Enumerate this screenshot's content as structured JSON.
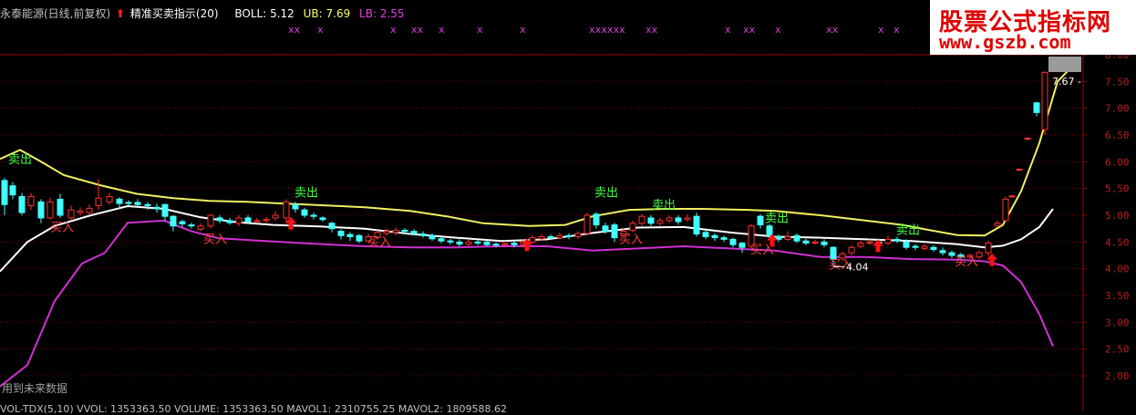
{
  "header": {
    "stock_title": "永泰能源(日线,前复权)",
    "indicator_name": "精准买卖指示(20)",
    "boll_label": "BOLL: 5.12",
    "ub_label": "UB: 7.69",
    "lb_label": "LB: 2.55",
    "colors": {
      "title": "#c0c0c0",
      "indicator": "#ffffff",
      "arrow": "#ff2020",
      "boll": "#ffffff",
      "ub": "#ffff60",
      "lb": "#e040e0"
    }
  },
  "watermark": {
    "line1": "股票公式指标网",
    "line2": "www.gszb.com"
  },
  "footer": {
    "future_warning": "用到未来数据",
    "volume_line": "VOL-TDX(5,10)  VVOL: 1353363.50  VOLUME: 1353363.50  MAVOL1: 2310755.25  MAVOL2: 1809588.62"
  },
  "chart_data": {
    "type": "candlestick",
    "yticks": [
      "8.00",
      "7.50",
      "7.00",
      "6.50",
      "6.00",
      "5.50",
      "5.00",
      "4.50",
      "4.00",
      "3.50",
      "3.00",
      "2.50",
      "2.00"
    ],
    "ylim": [
      1.9,
      8.05
    ],
    "price_box_label": "7.67",
    "low_label": "4.04",
    "x_marks": [
      {
        "x": 316,
        "text": "xx"
      },
      {
        "x": 348,
        "text": "x"
      },
      {
        "x": 428,
        "text": "x"
      },
      {
        "x": 451,
        "text": "xx"
      },
      {
        "x": 481,
        "text": "x"
      },
      {
        "x": 523,
        "text": "x"
      },
      {
        "x": 570,
        "text": "x"
      },
      {
        "x": 646,
        "text": "xxxxxx"
      },
      {
        "x": 708,
        "text": "xx"
      },
      {
        "x": 795,
        "text": "x"
      },
      {
        "x": 815,
        "text": "xx"
      },
      {
        "x": 850,
        "text": "x"
      },
      {
        "x": 906,
        "text": "xx"
      },
      {
        "x": 963,
        "text": "x"
      },
      {
        "x": 980,
        "text": "x"
      }
    ],
    "sell_labels": [
      {
        "x": 22,
        "v": 5.97,
        "text": "卖出"
      },
      {
        "x": 336,
        "v": 5.35,
        "text": "卖出"
      },
      {
        "x": 665,
        "v": 5.35,
        "text": "卖出"
      },
      {
        "x": 728,
        "v": 5.12,
        "text": "卖出"
      },
      {
        "x": 852,
        "v": 4.87,
        "text": "卖出"
      },
      {
        "x": 996,
        "v": 4.65,
        "text": "卖出"
      }
    ],
    "buy_labels": [
      {
        "x": 68,
        "v": 4.7,
        "text": "买入"
      },
      {
        "x": 236,
        "v": 4.48,
        "text": "买入"
      },
      {
        "x": 416,
        "v": 4.43,
        "text": "买入"
      },
      {
        "x": 692,
        "v": 4.48,
        "text": "买入"
      },
      {
        "x": 836,
        "v": 4.28,
        "text": "买入"
      },
      {
        "x": 922,
        "v": 4.0,
        "text": "买入"
      },
      {
        "x": 1060,
        "v": 4.06,
        "text": "买入"
      }
    ],
    "buy_arrows": [
      {
        "x": 319,
        "v": 4.8
      },
      {
        "x": 578,
        "v": 4.4
      },
      {
        "x": 847,
        "v": 4.48
      },
      {
        "x": 963,
        "v": 4.38
      },
      {
        "x": 1088,
        "v": 4.12
      }
    ],
    "ub": [
      [
        0,
        6.05
      ],
      [
        22,
        6.22
      ],
      [
        45,
        6.0
      ],
      [
        70,
        5.75
      ],
      [
        110,
        5.56
      ],
      [
        150,
        5.4
      ],
      [
        190,
        5.32
      ],
      [
        230,
        5.27
      ],
      [
        270,
        5.25
      ],
      [
        310,
        5.22
      ],
      [
        350,
        5.19
      ],
      [
        400,
        5.15
      ],
      [
        450,
        5.08
      ],
      [
        490,
        4.98
      ],
      [
        530,
        4.85
      ],
      [
        580,
        4.8
      ],
      [
        620,
        4.82
      ],
      [
        650,
        4.98
      ],
      [
        690,
        5.1
      ],
      [
        730,
        5.12
      ],
      [
        770,
        5.12
      ],
      [
        820,
        5.1
      ],
      [
        850,
        5.08
      ],
      [
        900,
        5.0
      ],
      [
        950,
        4.9
      ],
      [
        990,
        4.82
      ],
      [
        1020,
        4.72
      ],
      [
        1050,
        4.63
      ],
      [
        1080,
        4.62
      ],
      [
        1100,
        4.82
      ],
      [
        1120,
        5.45
      ],
      [
        1140,
        6.35
      ],
      [
        1160,
        7.5
      ],
      [
        1180,
        7.85
      ]
    ],
    "mid": [
      [
        0,
        3.95
      ],
      [
        30,
        4.5
      ],
      [
        60,
        4.8
      ],
      [
        100,
        5.0
      ],
      [
        140,
        5.17
      ],
      [
        180,
        5.12
      ],
      [
        220,
        4.96
      ],
      [
        260,
        4.87
      ],
      [
        300,
        4.82
      ],
      [
        350,
        4.79
      ],
      [
        400,
        4.75
      ],
      [
        450,
        4.65
      ],
      [
        500,
        4.58
      ],
      [
        550,
        4.52
      ],
      [
        600,
        4.55
      ],
      [
        650,
        4.67
      ],
      [
        700,
        4.77
      ],
      [
        750,
        4.78
      ],
      [
        800,
        4.68
      ],
      [
        850,
        4.6
      ],
      [
        900,
        4.58
      ],
      [
        950,
        4.55
      ],
      [
        1000,
        4.52
      ],
      [
        1050,
        4.46
      ],
      [
        1080,
        4.4
      ],
      [
        1100,
        4.43
      ],
      [
        1120,
        4.55
      ],
      [
        1140,
        4.78
      ],
      [
        1155,
        5.12
      ]
    ],
    "lb": [
      [
        0,
        1.8
      ],
      [
        30,
        2.2
      ],
      [
        60,
        3.4
      ],
      [
        90,
        4.1
      ],
      [
        115,
        4.3
      ],
      [
        140,
        4.86
      ],
      [
        180,
        4.9
      ],
      [
        210,
        4.7
      ],
      [
        240,
        4.57
      ],
      [
        280,
        4.53
      ],
      [
        330,
        4.48
      ],
      [
        400,
        4.42
      ],
      [
        450,
        4.4
      ],
      [
        500,
        4.4
      ],
      [
        550,
        4.42
      ],
      [
        600,
        4.42
      ],
      [
        650,
        4.34
      ],
      [
        700,
        4.38
      ],
      [
        750,
        4.42
      ],
      [
        800,
        4.38
      ],
      [
        850,
        4.34
      ],
      [
        900,
        4.22
      ],
      [
        950,
        4.22
      ],
      [
        1000,
        4.18
      ],
      [
        1050,
        4.17
      ],
      [
        1080,
        4.14
      ],
      [
        1100,
        4.06
      ],
      [
        1120,
        3.75
      ],
      [
        1140,
        3.15
      ],
      [
        1155,
        2.55
      ]
    ],
    "candles": [
      [
        5,
        5.2,
        5.65,
        5.0,
        5.7,
        "d"
      ],
      [
        14,
        5.55,
        5.38,
        5.3,
        5.62,
        "d"
      ],
      [
        24,
        5.35,
        5.05,
        5.0,
        5.42,
        "d"
      ],
      [
        34,
        5.18,
        5.35,
        5.1,
        5.42,
        "u"
      ],
      [
        45,
        5.25,
        4.95,
        4.85,
        5.3,
        "d"
      ],
      [
        55,
        4.95,
        5.25,
        4.92,
        5.33,
        "u"
      ],
      [
        66,
        5.3,
        5.0,
        4.95,
        5.4,
        "d"
      ],
      [
        78,
        4.95,
        5.1,
        4.9,
        5.18,
        "u"
      ],
      [
        88,
        5.05,
        5.08,
        5.0,
        5.15,
        "u"
      ],
      [
        98,
        5.05,
        5.13,
        5.0,
        5.2,
        "u"
      ],
      [
        108,
        5.18,
        5.32,
        5.1,
        5.68,
        "u"
      ],
      [
        120,
        5.25,
        5.35,
        5.2,
        5.42,
        "u"
      ],
      [
        131,
        5.3,
        5.22,
        5.15,
        5.34,
        "d"
      ],
      [
        141,
        5.24,
        5.22,
        5.18,
        5.28,
        "d"
      ],
      [
        151,
        5.24,
        5.2,
        5.15,
        5.3,
        "d"
      ],
      [
        162,
        5.2,
        5.18,
        5.1,
        5.25,
        "d"
      ],
      [
        172,
        5.15,
        5.12,
        5.05,
        5.22,
        "d"
      ],
      [
        181,
        5.2,
        4.98,
        4.9,
        5.22,
        "d"
      ],
      [
        190,
        4.98,
        4.8,
        4.7,
        5.0,
        "d"
      ],
      [
        200,
        4.88,
        4.84,
        4.78,
        4.92,
        "d"
      ],
      [
        210,
        4.82,
        4.8,
        4.75,
        4.86,
        "d"
      ],
      [
        220,
        4.74,
        4.8,
        4.7,
        4.85,
        "u"
      ],
      [
        231,
        4.8,
        5.0,
        4.75,
        5.02,
        "u"
      ],
      [
        241,
        4.95,
        4.9,
        4.85,
        5.0,
        "d"
      ],
      [
        252,
        4.9,
        4.86,
        4.82,
        4.95,
        "d"
      ],
      [
        262,
        4.85,
        4.95,
        4.8,
        5.0,
        "u"
      ],
      [
        272,
        4.95,
        4.88,
        4.84,
        5.0,
        "d"
      ],
      [
        282,
        4.88,
        4.9,
        4.85,
        4.95,
        "u"
      ],
      [
        292,
        4.9,
        4.92,
        4.85,
        4.97,
        "u"
      ],
      [
        302,
        4.95,
        5.0,
        4.9,
        5.08,
        "u"
      ],
      [
        314,
        4.95,
        5.25,
        4.85,
        5.3,
        "u"
      ],
      [
        324,
        5.2,
        5.12,
        5.05,
        5.25,
        "d"
      ],
      [
        334,
        5.1,
        5.0,
        4.95,
        5.14,
        "d"
      ],
      [
        344,
        5.0,
        4.98,
        4.92,
        5.05,
        "d"
      ],
      [
        354,
        4.95,
        4.92,
        4.88,
        4.98,
        "d"
      ],
      [
        364,
        4.85,
        4.75,
        4.68,
        4.88,
        "d"
      ],
      [
        374,
        4.7,
        4.62,
        4.55,
        4.74,
        "d"
      ],
      [
        384,
        4.64,
        4.6,
        4.52,
        4.68,
        "d"
      ],
      [
        394,
        4.62,
        4.52,
        4.48,
        4.65,
        "d"
      ],
      [
        404,
        4.52,
        4.6,
        4.48,
        4.66,
        "u"
      ],
      [
        414,
        4.58,
        4.68,
        4.55,
        4.72,
        "u"
      ],
      [
        424,
        4.66,
        4.7,
        4.62,
        4.75,
        "u"
      ],
      [
        434,
        4.68,
        4.72,
        4.62,
        4.77,
        "u"
      ],
      [
        444,
        4.72,
        4.7,
        4.65,
        4.76,
        "d"
      ],
      [
        454,
        4.7,
        4.66,
        4.62,
        4.74,
        "d"
      ],
      [
        464,
        4.65,
        4.62,
        4.58,
        4.7,
        "d"
      ],
      [
        474,
        4.62,
        4.56,
        4.52,
        4.66,
        "d"
      ],
      [
        484,
        4.56,
        4.52,
        4.48,
        4.6,
        "d"
      ],
      [
        494,
        4.52,
        4.5,
        4.45,
        4.56,
        "d"
      ],
      [
        504,
        4.5,
        4.46,
        4.42,
        4.55,
        "d"
      ],
      [
        514,
        4.46,
        4.5,
        4.42,
        4.54,
        "u"
      ],
      [
        524,
        4.5,
        4.48,
        4.44,
        4.54,
        "d"
      ],
      [
        534,
        4.5,
        4.45,
        4.42,
        4.52,
        "d"
      ],
      [
        544,
        4.46,
        4.44,
        4.4,
        4.5,
        "d"
      ],
      [
        554,
        4.45,
        4.47,
        4.4,
        4.52,
        "u"
      ],
      [
        564,
        4.48,
        4.45,
        4.4,
        4.52,
        "d"
      ],
      [
        574,
        4.45,
        4.5,
        4.4,
        4.55,
        "u"
      ],
      [
        584,
        4.5,
        4.58,
        4.46,
        4.62,
        "u"
      ],
      [
        594,
        4.56,
        4.6,
        4.52,
        4.65,
        "u"
      ],
      [
        604,
        4.6,
        4.58,
        4.55,
        4.64,
        "d"
      ],
      [
        614,
        4.58,
        4.62,
        4.55,
        4.68,
        "u"
      ],
      [
        624,
        4.62,
        4.6,
        4.55,
        4.66,
        "d"
      ],
      [
        634,
        4.6,
        4.66,
        4.56,
        4.7,
        "u"
      ],
      [
        644,
        4.66,
        5.0,
        4.62,
        5.05,
        "u"
      ],
      [
        654,
        5.02,
        4.82,
        4.75,
        5.06,
        "d"
      ],
      [
        664,
        4.8,
        4.7,
        4.65,
        4.86,
        "d"
      ],
      [
        674,
        4.82,
        4.58,
        4.5,
        4.86,
        "d"
      ],
      [
        684,
        4.62,
        4.7,
        4.58,
        4.76,
        "u"
      ],
      [
        694,
        4.72,
        4.85,
        4.68,
        4.9,
        "u"
      ],
      [
        704,
        4.85,
        4.98,
        4.8,
        5.02,
        "u"
      ],
      [
        714,
        4.95,
        4.85,
        4.8,
        5.0,
        "d"
      ],
      [
        724,
        4.85,
        4.9,
        4.8,
        4.95,
        "u"
      ],
      [
        734,
        4.9,
        4.95,
        4.85,
        5.0,
        "u"
      ],
      [
        744,
        4.95,
        4.88,
        4.82,
        5.0,
        "d"
      ],
      [
        754,
        4.92,
        4.95,
        4.88,
        5.02,
        "u"
      ],
      [
        764,
        4.98,
        4.65,
        4.6,
        5.05,
        "d"
      ],
      [
        774,
        4.68,
        4.6,
        4.55,
        4.72,
        "d"
      ],
      [
        784,
        4.62,
        4.58,
        4.52,
        4.66,
        "d"
      ],
      [
        794,
        4.58,
        4.55,
        4.5,
        4.62,
        "d"
      ],
      [
        804,
        4.55,
        4.45,
        4.4,
        4.58,
        "d"
      ],
      [
        814,
        4.48,
        4.4,
        4.3,
        4.5,
        "d"
      ],
      [
        824,
        4.42,
        4.8,
        4.38,
        4.84,
        "u"
      ],
      [
        834,
        4.98,
        4.82,
        4.75,
        5.02,
        "d"
      ],
      [
        844,
        4.8,
        4.62,
        4.58,
        4.84,
        "d"
      ],
      [
        854,
        4.6,
        4.55,
        4.5,
        4.64,
        "d"
      ],
      [
        864,
        4.55,
        4.6,
        4.52,
        4.7,
        "u"
      ],
      [
        874,
        4.62,
        4.52,
        4.48,
        4.66,
        "d"
      ],
      [
        884,
        4.52,
        4.48,
        4.44,
        4.56,
        "d"
      ],
      [
        894,
        4.48,
        4.5,
        4.45,
        4.54,
        "u"
      ],
      [
        904,
        4.5,
        4.45,
        4.4,
        4.55,
        "d"
      ],
      [
        914,
        4.4,
        4.18,
        4.04,
        4.42,
        "d"
      ],
      [
        924,
        4.2,
        4.28,
        4.15,
        4.32,
        "u"
      ],
      [
        934,
        4.3,
        4.4,
        4.25,
        4.44,
        "u"
      ],
      [
        944,
        4.42,
        4.48,
        4.38,
        4.52,
        "u"
      ],
      [
        954,
        4.48,
        4.5,
        4.44,
        4.55,
        "u"
      ],
      [
        964,
        4.5,
        4.46,
        4.42,
        4.55,
        "d"
      ],
      [
        974,
        4.48,
        4.55,
        4.44,
        4.62,
        "u"
      ],
      [
        984,
        4.55,
        4.52,
        4.48,
        4.6,
        "d"
      ],
      [
        994,
        4.5,
        4.4,
        4.36,
        4.55,
        "d"
      ],
      [
        1004,
        4.42,
        4.4,
        4.35,
        4.46,
        "d"
      ],
      [
        1014,
        4.38,
        4.42,
        4.34,
        4.46,
        "u"
      ],
      [
        1024,
        4.4,
        4.36,
        4.32,
        4.44,
        "d"
      ],
      [
        1034,
        4.34,
        4.3,
        4.25,
        4.4,
        "d"
      ],
      [
        1044,
        4.3,
        4.25,
        4.2,
        4.34,
        "d"
      ],
      [
        1054,
        4.26,
        4.22,
        4.18,
        4.3,
        "d"
      ],
      [
        1064,
        4.22,
        4.25,
        4.18,
        4.28,
        "u"
      ],
      [
        1074,
        4.22,
        4.3,
        4.18,
        4.34,
        "u"
      ],
      [
        1084,
        4.3,
        4.48,
        4.24,
        4.52,
        "u"
      ],
      [
        1094,
        4.8,
        4.85,
        4.8,
        4.9,
        "u"
      ],
      [
        1103,
        4.9,
        5.3,
        4.88,
        5.35,
        "u"
      ],
      [
        1110,
        5.35,
        5.36,
        5.33,
        5.38,
        "u"
      ],
      [
        1118,
        5.85,
        5.86,
        5.83,
        5.88,
        "u"
      ],
      [
        1127,
        6.42,
        6.44,
        6.4,
        6.46,
        "u"
      ],
      [
        1137,
        7.1,
        6.92,
        6.85,
        7.12,
        "d"
      ],
      [
        1146,
        6.6,
        7.67,
        6.5,
        7.69,
        "u"
      ]
    ]
  }
}
